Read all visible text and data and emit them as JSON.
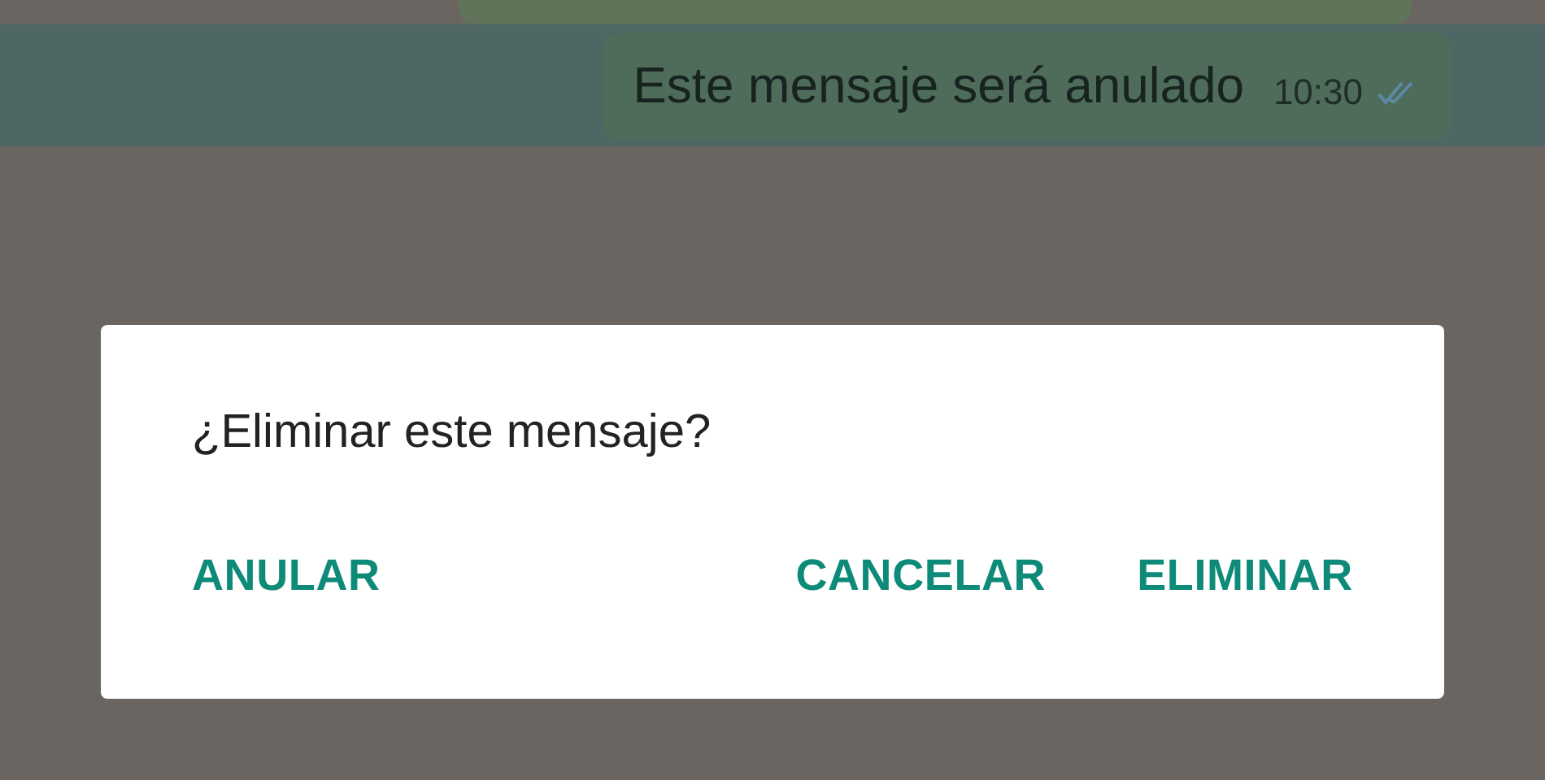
{
  "messages": [
    {
      "kind": "partial",
      "selected": false
    },
    {
      "kind": "full",
      "text": "Este mensaje será anulado",
      "time": "10:30",
      "selected": true
    }
  ],
  "dialog": {
    "title": "¿Eliminar este mensaje?",
    "buttons": [
      "ANULAR",
      "CANCELAR",
      "ELIMINAR"
    ]
  }
}
